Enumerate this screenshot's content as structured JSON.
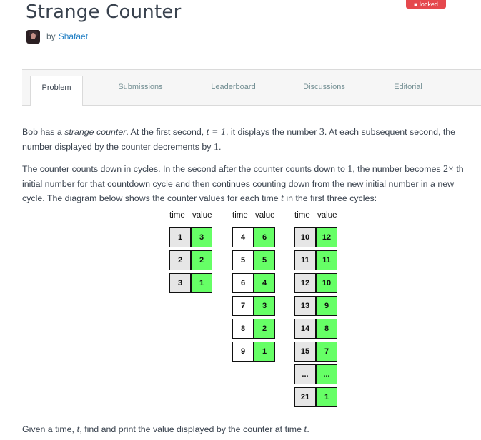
{
  "badge": "locked",
  "title": "Strange Counter",
  "byline": {
    "by": "by",
    "author": "Shafaet"
  },
  "tabs": [
    {
      "label": "Problem"
    },
    {
      "label": "Submissions"
    },
    {
      "label": "Leaderboard"
    },
    {
      "label": "Discussions"
    },
    {
      "label": "Editorial"
    }
  ],
  "para1": {
    "a": "Bob has a ",
    "em": "strange counter",
    "b": ". At the first second, ",
    "m1": "t = 1",
    "c": ", it displays the number ",
    "m2": "3",
    "d": ". At each subsequent second, the",
    "line2": "number displayed by the counter decrements by ",
    "m3": "1",
    "e": "."
  },
  "para2": {
    "a": "The counter counts down in cycles. In the second after the counter counts down to ",
    "m1": "1",
    "b": ", the number becomes ",
    "m2": "2×",
    "c": " th",
    "line2": "initial number for that countdown cycle and then continues counting down from the new initial number in a new",
    "line3a": "cycle. The diagram below shows the counter values for each time ",
    "m3": "t",
    "line3b": " in the first three cycles:"
  },
  "para3": {
    "a": "Given a time, ",
    "m1": "t",
    "b": ", find and print the value displayed by the counter at time ",
    "m2": "t",
    "c": "."
  },
  "diagram": {
    "header_time": "time",
    "header_value": "value",
    "cycles": [
      {
        "rows": [
          [
            "1",
            "3"
          ],
          [
            "2",
            "2"
          ],
          [
            "3",
            "1"
          ]
        ]
      },
      {
        "rows": [
          [
            "4",
            "6"
          ],
          [
            "5",
            "5"
          ],
          [
            "6",
            "4"
          ],
          [
            "7",
            "3"
          ],
          [
            "8",
            "2"
          ],
          [
            "9",
            "1"
          ]
        ]
      },
      {
        "rows": [
          [
            "10",
            "12"
          ],
          [
            "11",
            "11"
          ],
          [
            "12",
            "10"
          ],
          [
            "13",
            "9"
          ],
          [
            "14",
            "8"
          ],
          [
            "15",
            "7"
          ],
          [
            "...",
            "..."
          ],
          [
            "21",
            "1"
          ]
        ]
      }
    ],
    "colors": {
      "time_cell": "#e6e6e6",
      "value_cell": "#66ff66",
      "border": "#111111"
    }
  }
}
